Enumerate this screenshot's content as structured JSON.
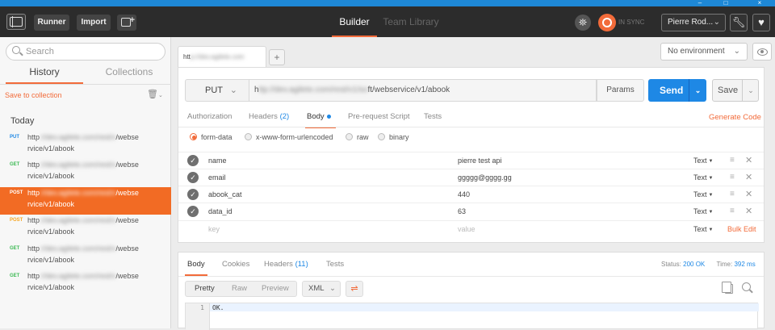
{
  "colors": {
    "accent": "#f26b3a",
    "send_blue": "#1e88e5",
    "header_bg": "#2c2c2c",
    "window_strip": "#1e88d6"
  },
  "window": {
    "minimize": "–",
    "maximize": "□",
    "close": "×"
  },
  "topbar": {
    "runner_label": "Runner",
    "import_label": "Import",
    "builder_label": "Builder",
    "team_library_label": "Team Library",
    "sync_label": "IN SYNC",
    "user_label": "Pierre Rod...",
    "icons": [
      "sidebar-toggle-icon",
      "new-tab-icon",
      "interceptor-icon",
      "sync-icon",
      "wrench-icon",
      "heart-icon"
    ]
  },
  "sidebar": {
    "search_placeholder": "Search",
    "tab_history": "History",
    "tab_collections": "Collections",
    "save_to_collection": "Save to collection",
    "today_label": "Today",
    "history": [
      {
        "method": "PUT",
        "method_color": "#1e88e5",
        "url_start": "http",
        "url_hidden": "://dev.agilete.com/rest/v",
        "url_end": "/webse",
        "url_line2": "rvice/v1/abook"
      },
      {
        "method": "GET",
        "method_color": "#3cba54",
        "url_start": "http",
        "url_hidden": "://dev.agilete.com/rest/v",
        "url_end": "/webse",
        "url_line2": "rvice/v1/abook"
      },
      {
        "method": "POST",
        "method_color": "#ffffff",
        "url_start": "http",
        "url_hidden": "://dev.agilete.com/rest/v",
        "url_end": "/webse",
        "url_line2": "rvice/v1/abook"
      },
      {
        "method": "POST",
        "method_color": "#f6a623",
        "url_start": "http",
        "url_hidden": "://dev.agilete.com/rest/v",
        "url_end": "/webse",
        "url_line2": "rvice/v1/abook"
      },
      {
        "method": "GET",
        "method_color": "#3cba54",
        "url_start": "http",
        "url_hidden": "://dev.agilete.com/rest/v",
        "url_end": "/webse",
        "url_line2": "rvice/v1/abook"
      },
      {
        "method": "GET",
        "method_color": "#3cba54",
        "url_start": "http",
        "url_hidden": "://dev.agilete.com/rest/v",
        "url_end": "/webse",
        "url_line2": "rvice/v1/abook"
      }
    ]
  },
  "request": {
    "tab_start": "htt",
    "tab_hidden": "p://dev.agilete.com",
    "add_tab": "+",
    "environment": "No environment",
    "method": "PUT",
    "url_start": "h",
    "url_hidden": "ttp://dev.agilete.com/rest/v1/so",
    "url_end": "ft/webservice/v1/abook",
    "params_label": "Params",
    "send_label": "Send",
    "save_label": "Save",
    "tabs": {
      "authorization": "Authorization",
      "headers": "Headers",
      "headers_count": "(2)",
      "body": "Body",
      "prerequest": "Pre-request Script",
      "tests": "Tests"
    },
    "generate_code": "Generate Code",
    "body_modes": [
      "form-data",
      "x-www-form-urlencoded",
      "raw",
      "binary"
    ],
    "form_rows": [
      {
        "key": "name",
        "value": "pierre test api",
        "type": "Text"
      },
      {
        "key": "email",
        "value": "ggggg@gggg.gg",
        "type": "Text"
      },
      {
        "key": "abook_cat",
        "value": "440",
        "type": "Text"
      },
      {
        "key": "data_id",
        "value": "63",
        "type": "Text"
      }
    ],
    "new_row": {
      "key_placeholder": "key",
      "value_placeholder": "value",
      "type": "Text"
    },
    "bulk_edit": "Bulk Edit"
  },
  "response": {
    "tabs": {
      "body": "Body",
      "cookies": "Cookies",
      "headers": "Headers",
      "headers_count": "(11)",
      "tests": "Tests"
    },
    "status_label": "Status:",
    "status_value": "200 OK",
    "time_label": "Time:",
    "time_value": "392 ms",
    "views": [
      "Pretty",
      "Raw",
      "Preview"
    ],
    "format": "XML",
    "line_number": "1",
    "body_text": "OK."
  }
}
